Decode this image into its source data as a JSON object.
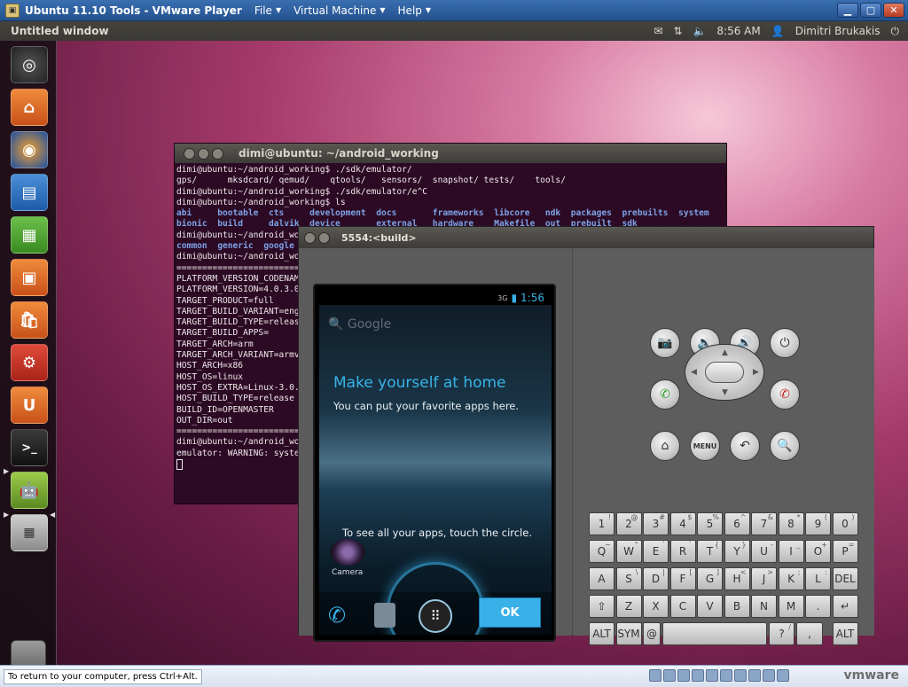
{
  "vmware": {
    "title": "Ubuntu 11.10 Tools - VMware Player",
    "menus": [
      "File",
      "Virtual Machine",
      "Help"
    ],
    "status_message": "To return to your computer, press Ctrl+Alt.",
    "brand": "vmware"
  },
  "ubuntu": {
    "window_title": "Untitled window",
    "clock": "8:56 AM",
    "user": "Dimitri Brukakis"
  },
  "terminal": {
    "title": "dimi@ubuntu: ~/android_working",
    "lines": [
      "dimi@ubuntu:~/android_working$ ./sdk/emulator/",
      "gps/      mksdcard/ qemud/    qtools/   sensors/  snapshot/ tests/    tools/",
      "dimi@ubuntu:~/android_working$ ./sdk/emulator/e^C",
      "dimi@ubuntu:~/android_working$ ls",
      "abi     bootable  cts     development  docs       frameworks  libcore   ndk  packages  prebuilts  system",
      "bionic  build     dalvik  device       external   hardware    Makefile  out  prebuilt  sdk",
      "dimi@ubuntu:~/android_working$",
      "common  generic  google",
      "dimi@ubuntu:~/android_working$",
      "",
      "============================================",
      "PLATFORM_VERSION_CODENAME",
      "PLATFORM_VERSION=4.0.3.0",
      "TARGET_PRODUCT=full",
      "TARGET_BUILD_VARIANT=eng",
      "TARGET_BUILD_TYPE=release",
      "TARGET_BUILD_APPS=",
      "TARGET_ARCH=arm",
      "TARGET_ARCH_VARIANT=armv",
      "HOST_ARCH=x86",
      "HOST_OS=linux",
      "HOST_OS_EXTRA=Linux-3.0.",
      "HOST_BUILD_TYPE=release",
      "BUILD_ID=OPENMASTER",
      "OUT_DIR=out",
      "============================================",
      "",
      "dimi@ubuntu:~/android_wo",
      "emulator: WARNING: syste"
    ]
  },
  "emulator": {
    "title": "5554:<build>",
    "phone": {
      "network": "3G",
      "time": "1:56",
      "search_hint": "Google",
      "welcome_title": "Make yourself at home",
      "welcome_text": "You can put your favorite apps here.",
      "hint": "To see all your apps, touch the circle.",
      "camera_label": "Camera",
      "ok": "OK"
    },
    "controls": {
      "menu_label": "MENU"
    },
    "keyboard": {
      "row1": [
        [
          "1",
          "!"
        ],
        [
          "2",
          "@"
        ],
        [
          "3",
          "#"
        ],
        [
          "4",
          "$"
        ],
        [
          "5",
          "%"
        ],
        [
          "6",
          "^"
        ],
        [
          "7",
          "&"
        ],
        [
          "8",
          "*"
        ],
        [
          "9",
          "("
        ],
        [
          "0",
          ")"
        ]
      ],
      "row2": [
        [
          "Q",
          "~"
        ],
        [
          "W",
          "\""
        ],
        [
          "E",
          "´"
        ],
        [
          "R",
          "`"
        ],
        [
          "T",
          "{"
        ],
        [
          "Y",
          "}"
        ],
        [
          "U",
          "-"
        ],
        [
          "I",
          "_"
        ],
        [
          "O",
          "+"
        ],
        [
          "P",
          "="
        ]
      ],
      "row3": [
        [
          "A",
          ""
        ],
        [
          "S",
          "\\"
        ],
        [
          "D",
          "|"
        ],
        [
          "F",
          "["
        ],
        [
          "G",
          "]"
        ],
        [
          "H",
          "<"
        ],
        [
          "J",
          ">"
        ],
        [
          "K",
          ";"
        ],
        [
          "L",
          ":"
        ],
        [
          "DEL",
          ""
        ]
      ],
      "row4": [
        "⇧",
        "Z",
        "X",
        "C",
        "V",
        "B",
        "N",
        "M",
        ".",
        "↵"
      ],
      "row5": [
        "ALT",
        "SYM",
        "@",
        "",
        "?",
        "ALT"
      ],
      "row5_sub": [
        "",
        "",
        "",
        "",
        "/",
        ""
      ],
      "comma": ","
    }
  }
}
